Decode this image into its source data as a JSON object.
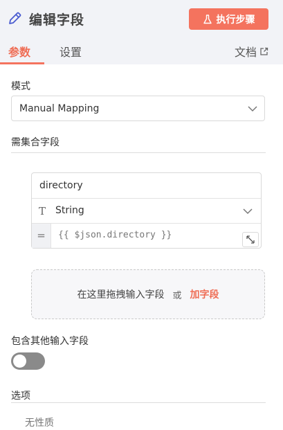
{
  "header": {
    "title": "编辑字段",
    "execute_button": "执行步骤",
    "tabs": [
      {
        "label": "参数",
        "active": true
      },
      {
        "label": "设置",
        "active": false
      }
    ],
    "docs_link": "文档"
  },
  "mode": {
    "label": "模式",
    "selected": "Manual Mapping"
  },
  "fields_section": {
    "label": "需集合字段",
    "field": {
      "name": "directory",
      "type": "String",
      "type_icon": "T",
      "equals": "=",
      "expression": "{{ $json.directory }}"
    },
    "dropzone": {
      "text": "在这里拖拽输入字段",
      "or": "或",
      "add_link": "加字段"
    }
  },
  "include_other": {
    "label": "包含其他输入字段",
    "enabled": false
  },
  "options": {
    "label": "选项",
    "empty_text": "无性质"
  },
  "colors": {
    "accent": "#f4735e",
    "toggle_off": "#8a8a8a",
    "header_bg": "#f2f3f7"
  },
  "icons": [
    "pencil-icon",
    "flask-icon",
    "external-link-icon",
    "chevron-down-icon",
    "text-type-icon",
    "expand-icon"
  ]
}
